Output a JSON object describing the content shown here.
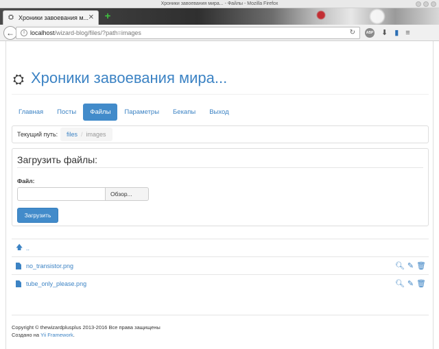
{
  "window": {
    "title": "Хроники завоевания мира... - Файлы - Mozilla Firefox"
  },
  "browser": {
    "tab_title": "Хроники завоевания м...",
    "url_host": "localhost",
    "url_path": "/wizard-blog/files/?path=images",
    "abp_label": "ABP"
  },
  "site": {
    "title": "Хроники завоевания мира..."
  },
  "nav": {
    "items": [
      {
        "label": "Главная"
      },
      {
        "label": "Посты"
      },
      {
        "label": "Файлы",
        "active": true
      },
      {
        "label": "Параметры"
      },
      {
        "label": "Бекапы"
      },
      {
        "label": "Выход"
      }
    ]
  },
  "breadcrumb": {
    "label": "Текущий путь:",
    "root": "files",
    "current": "images"
  },
  "upload": {
    "heading": "Загрузить файлы:",
    "file_label": "Файл:",
    "browse_label": "Обзор...",
    "submit_label": "Загрузить"
  },
  "files": {
    "parent": "..",
    "items": [
      {
        "name": "no_transistor.png"
      },
      {
        "name": "tube_only_please.png"
      }
    ]
  },
  "footer": {
    "copyright": "Copyright © thewizardplusplus 2013-2016 Все права защищены",
    "made_prefix": "Создано на ",
    "framework": "Yii Framework",
    "made_suffix": "."
  },
  "colors": {
    "accent": "#428bca",
    "link": "#3c83c4"
  }
}
